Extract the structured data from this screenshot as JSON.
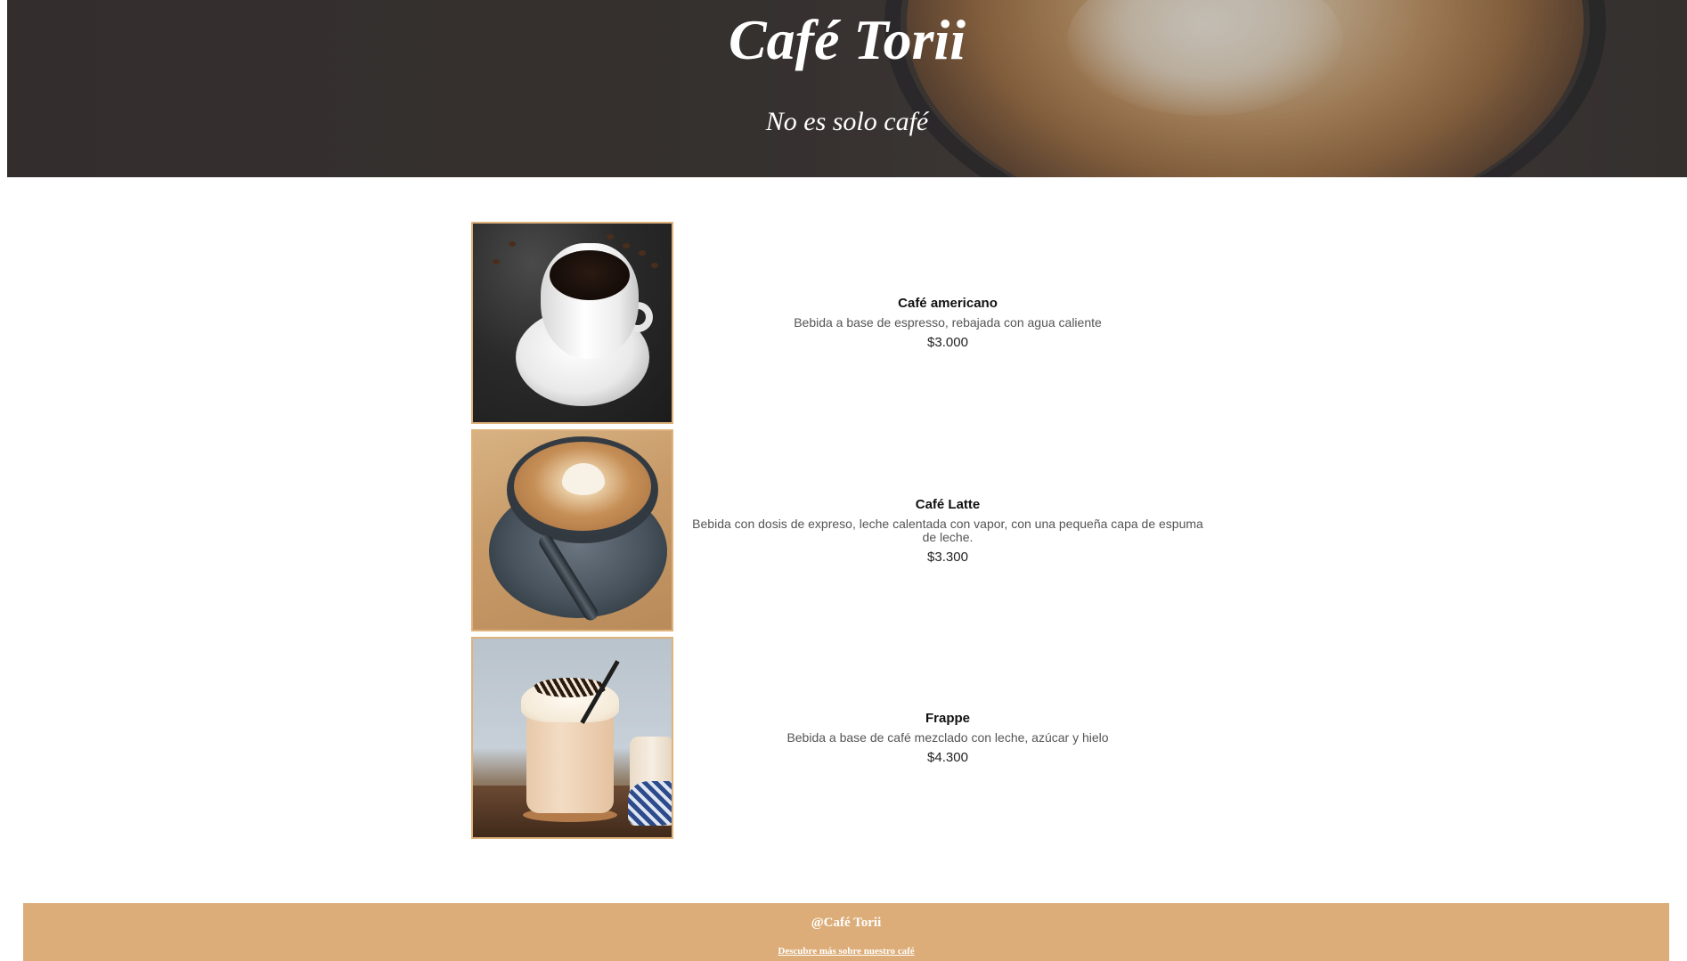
{
  "header": {
    "title": "Café Torii",
    "subtitle": "No es solo café"
  },
  "menu": {
    "items": [
      {
        "name": "Café americano",
        "description": "Bebida a base de espresso, rebajada con agua caliente",
        "price": "$3.000",
        "image_icon": "americano-photo"
      },
      {
        "name": "Café Latte",
        "description": "Bebida con dosis de expreso, leche calentada con vapor, con una pequeña capa de espuma de leche.",
        "price": "$3.300",
        "image_icon": "latte-photo"
      },
      {
        "name": "Frappe",
        "description": "Bebida a base de café mezclado con leche, azúcar y hielo",
        "price": "$4.300",
        "image_icon": "frappe-photo"
      }
    ]
  },
  "footer": {
    "brand": "@Café Torii",
    "link_text": "Descubre más sobre nuestro café"
  },
  "colors": {
    "footer_bg": "#dcad78",
    "photo_border": "#deb27a",
    "hero_bg": "#3a3533"
  }
}
